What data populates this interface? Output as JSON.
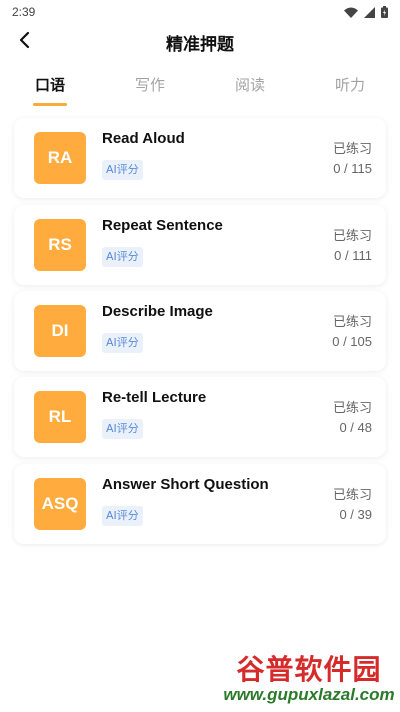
{
  "status_bar": {
    "time": "2:39",
    "icons": [
      "wifi-icon",
      "signal-icon",
      "battery-icon"
    ]
  },
  "header": {
    "back_icon": "chevron-left-icon",
    "title": "精准押题"
  },
  "tabs": [
    {
      "label": "口语",
      "active": true
    },
    {
      "label": "写作",
      "active": false
    },
    {
      "label": "阅读",
      "active": false
    },
    {
      "label": "听力",
      "active": false
    }
  ],
  "items": [
    {
      "abbr": "RA",
      "title": "Read Aloud",
      "tag": "AI评分",
      "practiced_label": "已练习",
      "progress": "0 / 115"
    },
    {
      "abbr": "RS",
      "title": "Repeat Sentence",
      "tag": "AI评分",
      "practiced_label": "已练习",
      "progress": "0 / 111"
    },
    {
      "abbr": "DI",
      "title": "Describe Image",
      "tag": "AI评分",
      "practiced_label": "已练习",
      "progress": "0 / 105"
    },
    {
      "abbr": "RL",
      "title": "Re-tell Lecture",
      "tag": "AI评分",
      "practiced_label": "已练习",
      "progress": "0 / 48"
    },
    {
      "abbr": "ASQ",
      "title": "Answer Short Question",
      "tag": "AI评分",
      "practiced_label": "已练习",
      "progress": "0 / 39"
    }
  ],
  "watermark": {
    "main": "谷普软件园",
    "url": "www.gupuxlazal.com"
  },
  "colors": {
    "accent": "#ffab3d",
    "tag_bg": "#eaf1fb",
    "tag_text": "#5a8bd8"
  }
}
